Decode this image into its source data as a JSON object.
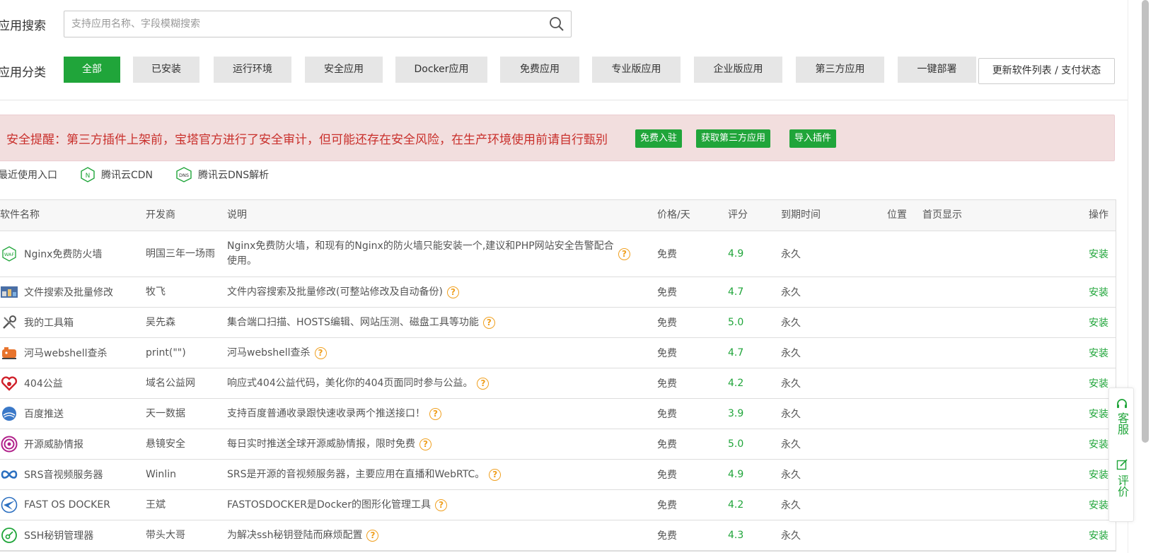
{
  "search": {
    "label": "应用搜索",
    "placeholder": "支持应用名称、字段模糊搜索"
  },
  "categories": {
    "label": "应用分类",
    "items": [
      "全部",
      "已安装",
      "运行环境",
      "安全应用",
      "Docker应用",
      "免费应用",
      "专业版应用",
      "企业版应用",
      "第三方应用",
      "一键部署"
    ],
    "update_button": "更新软件列表 / 支付状态"
  },
  "alert": {
    "text": "安全提醒：第三方插件上架前，宝塔官方进行了安全审计，但可能还存在安全风险，在生产环境使用前请自行甄别",
    "buttons": [
      "免费入驻",
      "获取第三方应用",
      "导入插件"
    ]
  },
  "recent": {
    "label": "最近使用入口",
    "items": [
      "腾讯云CDN",
      "腾讯云DNS解析"
    ]
  },
  "table": {
    "headers": [
      "软件名称",
      "开发商",
      "说明",
      "价格/天",
      "评分",
      "到期时间",
      "位置",
      "首页显示",
      "操作"
    ],
    "rows": [
      {
        "name": "Nginx免费防火墙",
        "dev": "明国三年一场雨",
        "desc": "Nginx免费防火墙，和现有的Nginx的防火墙只能安装一个,建议和PHP网站安全告警配合使用。",
        "price": "免费",
        "score": "4.9",
        "expire": "永久",
        "op": "安装"
      },
      {
        "name": "文件搜索及批量修改",
        "dev": "牧飞",
        "desc": "文件内容搜索及批量修改(可整站修改及自动备份)",
        "price": "免费",
        "score": "4.7",
        "expire": "永久",
        "op": "安装"
      },
      {
        "name": "我的工具箱",
        "dev": "吴先森",
        "desc": "集合端口扫描、HOSTS编辑、网站压测、磁盘工具等功能",
        "price": "免费",
        "score": "5.0",
        "expire": "永久",
        "op": "安装"
      },
      {
        "name": "河马webshell查杀",
        "dev": "print(\"\")",
        "desc": "河马webshell查杀",
        "price": "免费",
        "score": "4.7",
        "expire": "永久",
        "op": "安装"
      },
      {
        "name": "404公益",
        "dev": "域名公益网",
        "desc": "响应式404公益代码，美化你的404页面同时参与公益。",
        "price": "免费",
        "score": "4.2",
        "expire": "永久",
        "op": "安装"
      },
      {
        "name": "百度推送",
        "dev": "天一数据",
        "desc": "支持百度普通收录跟快速收录两个推送接口！",
        "price": "免费",
        "score": "3.9",
        "expire": "永久",
        "op": "安装"
      },
      {
        "name": "开源威胁情报",
        "dev": "悬镜安全",
        "desc": "每日实时推送全球开源威胁情报，限时免费",
        "price": "免费",
        "score": "5.0",
        "expire": "永久",
        "op": "安装"
      },
      {
        "name": "SRS音视频服务器",
        "dev": "Winlin",
        "desc": "SRS是开源的音视频服务器，主要应用在直播和WebRTC。",
        "price": "免费",
        "score": "4.9",
        "expire": "永久",
        "op": "安装"
      },
      {
        "name": "FAST OS DOCKER",
        "dev": "王斌",
        "desc": "FASTOSDOCKER是Docker的图形化管理工具",
        "price": "免费",
        "score": "4.2",
        "expire": "永久",
        "op": "安装"
      },
      {
        "name": "SSH秘钥管理器",
        "dev": "带头大哥",
        "desc": "为解决ssh秘钥登陆而麻烦配置",
        "price": "免费",
        "score": "4.3",
        "expire": "永久",
        "op": "安装"
      }
    ]
  },
  "float_panel": {
    "service": "客服",
    "rate": "评价"
  },
  "colors": {
    "accent": "#20a53a",
    "alert_bg": "#f2dede",
    "alert_text": "#c9302c",
    "help": "#f0a020"
  }
}
